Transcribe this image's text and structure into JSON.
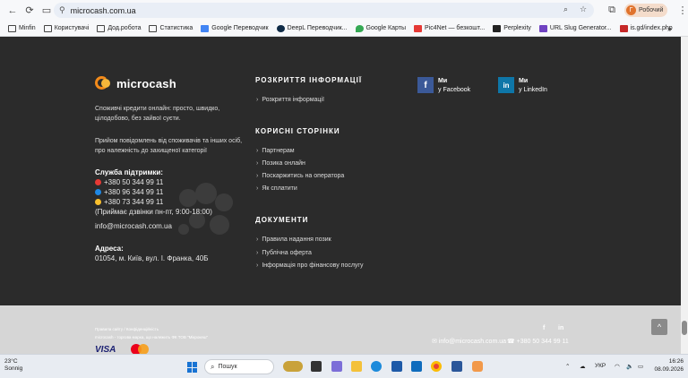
{
  "browser": {
    "url": "microcash.com.ua",
    "profile_initial": "Г",
    "profile_name": "Робочий"
  },
  "bookmarks": [
    {
      "label": "Minfin",
      "type": "folder"
    },
    {
      "label": "Користувачі",
      "type": "folder"
    },
    {
      "label": "Дод.робота",
      "type": "folder"
    },
    {
      "label": "Статистика",
      "type": "folder"
    },
    {
      "label": "Google Переводчик",
      "type": "site",
      "color": "#4285f4"
    },
    {
      "label": "DeepL Переводчик...",
      "type": "site",
      "color": "#0f2b46"
    },
    {
      "label": "Google Карты",
      "type": "site",
      "color": "#34a853"
    },
    {
      "label": "Pic4Net — безкошт...",
      "type": "site",
      "color": "#e53935"
    },
    {
      "label": "Perplexity",
      "type": "site",
      "color": "#20808d"
    },
    {
      "label": "URL Slug Generator...",
      "type": "site",
      "color": "#6f42c1"
    },
    {
      "label": "is.gd/index.php",
      "type": "site",
      "color": "#c62828"
    }
  ],
  "footer": {
    "logo_text": "microcash",
    "desc1": "Споживчі кредити онлайн: просто, швидко, цілодобово, без зайвої суєти.",
    "desc2": "Прийом повідомлень від споживачів та інших осіб, про належність до захищеної категорії",
    "support_title": "Служба підтримки:",
    "phones": [
      {
        "number": "+380 50 344 99 11",
        "color": "#e53935"
      },
      {
        "number": "+380 96 344 99 11",
        "color": "#1e88e5"
      },
      {
        "number": "+380 73 344 99 11",
        "color": "#fbc02d"
      }
    ],
    "hours": "(Приймає дзвінки пн-пт, 9:00-18:00)",
    "email": "info@microcash.com.ua",
    "address_title": "Адреса:",
    "address": "01054, м. Київ, вул. І. Франка, 40Б",
    "sections": [
      {
        "title": "РОЗКРИТТЯ ІНФОРМАЦІЇ",
        "links": [
          "Розкриття інформації"
        ]
      },
      {
        "title": "КОРИСНІ СТОРІНКИ",
        "links": [
          "Партнерам",
          "Позика онлайн",
          "Поскаржитись на оператора",
          "Як сплатити"
        ]
      },
      {
        "title": "ДОКУМЕНТИ",
        "links": [
          "Правила надання позик",
          "Публічна оферта",
          "Інформація про фінансову послугу"
        ]
      }
    ],
    "social": [
      {
        "icon": "f",
        "line1": "Ми",
        "line2": "у Facebook",
        "color": "#3b5998"
      },
      {
        "icon": "in",
        "line1": "Ми",
        "line2": "у LinkedIn",
        "color": "#0e76a8"
      }
    ]
  },
  "bottom": {
    "legal1": "Правила сайту  /  Конфіденційність",
    "legal2": "microcash - торгова марка, що належить ФК ТОВ \"Мікрокеш\"",
    "visa": "VISA",
    "contact_email": "info@microcash.com.ua",
    "contact_phone": "+380 50 344 99 11",
    "social_f": "f",
    "social_in": "in",
    "to_top": "^"
  },
  "taskbar": {
    "temp": "23°C",
    "weather": "Sonnig",
    "search": "Пошук",
    "lang": "УКР",
    "time": "16:26",
    "date": "08.09.2026"
  }
}
